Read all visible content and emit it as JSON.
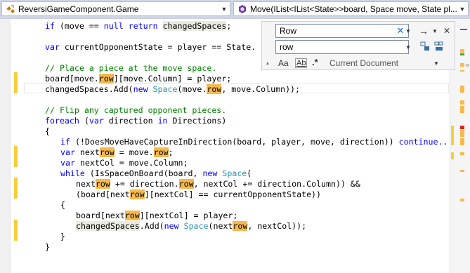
{
  "nav": {
    "type_combo": "ReversiGameComponent.Game",
    "member_combo": "Move(IList<IList<State>>board, Space move, State pl..."
  },
  "find": {
    "search_value": "Row",
    "replace_value": "row",
    "scope": "Current Document",
    "match_case_label": "Aa",
    "whole_word_label": "Ab",
    "regex_label": ".*"
  },
  "code": {
    "l1_a": "if (move == ",
    "l1_kw_if": "if",
    "l1_null": "null",
    "l1_return": "return",
    "l1_changed": "changedSpaces",
    "l1_end": ";",
    "l2_var": "var",
    "l2_text": " currentOpponentState = player == State.",
    "l3_comment": "// Place a piece at the move space.",
    "l4_a": "board[move.",
    "l4_row": "row",
    "l4_b": "][move.Column] = player;",
    "l5_a": "changedSpaces.Add(",
    "l5_new": "new",
    "l5_space": "Space",
    "l5_b": "(move.",
    "l5_row": "row",
    "l5_c": ", move.Column));",
    "l6_comment": "// Flip any captured opponent pieces.",
    "l7_foreach": "foreach",
    "l7_a": " (",
    "l7_var": "var",
    "l7_b": " direction ",
    "l7_in": "in",
    "l7_c": " Directions)",
    "l8": "{",
    "l9_if": "if",
    "l9_a": " (!DoesMoveHaveCaptureInDirection(board, player, move, direction)) ",
    "l9_continue": "continue...",
    "l10_var": "var",
    "l10_a": " next",
    "l10_row": "row",
    "l10_b": " = move.",
    "l10_row2": "row",
    "l10_c": ";",
    "l11_var": "var",
    "l11_a": " nextCol = move.Column;",
    "l12_while": "while",
    "l12_a": " (IsSpaceOnBoard(board, ",
    "l12_new": "new",
    "l12_space": "Space",
    "l12_b": "(",
    "l13_a": "next",
    "l13_row": "row",
    "l13_b": " += direction.",
    "l13_row2": "row",
    "l13_c": ", nextCol += direction.Column)) &&",
    "l14_a": "(board[next",
    "l14_row": "row",
    "l14_b": "][nextCol] == currentOpponentState))",
    "l15": "{",
    "l16_a": "board[next",
    "l16_row": "row",
    "l16_b": "][nextCol] = player;",
    "l17_changed": "changedSpaces",
    "l17_a": ".Add(",
    "l17_new": "new",
    "l17_space": "Space",
    "l17_b": "(next",
    "l17_row": "row",
    "l17_c": ", nextCol));",
    "l18": "}",
    "l19": "}"
  },
  "colors": {
    "keyword": "#0000ff",
    "type": "#2b91af",
    "comment": "#008000",
    "find_highlight": "#f6b94d",
    "changed_margin": "#f5cf3a"
  }
}
